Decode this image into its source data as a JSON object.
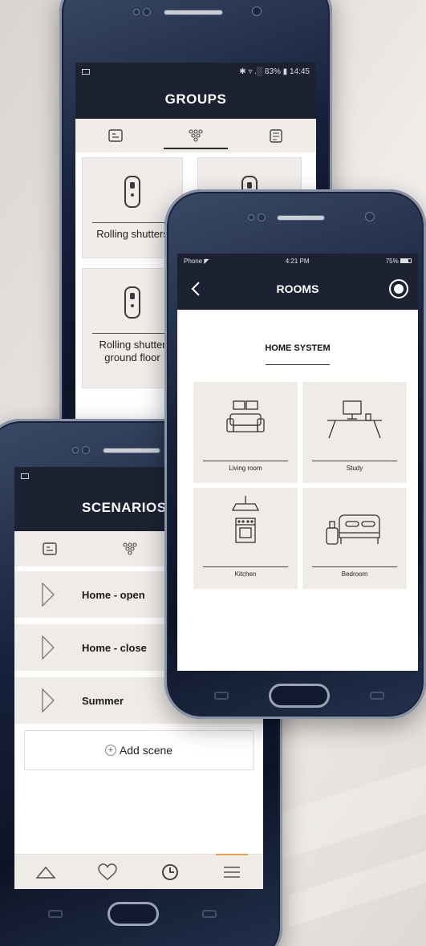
{
  "groups_screen": {
    "status": "✱ ▿ .░ 83% ▮ 14:45",
    "title": "GROUPS",
    "tab_icons": [
      "device-icon",
      "groups-icon",
      "scenario-icon"
    ],
    "active_tab": 1,
    "cards": [
      {
        "label": "Rolling shutters"
      },
      {
        "label": ""
      },
      {
        "label": "Rolling shutter ground floor"
      },
      {
        "label": ""
      }
    ]
  },
  "scenarios_screen": {
    "title": "SCENARIOS",
    "tab_icons": [
      "device-icon",
      "groups-icon"
    ],
    "scenes": [
      {
        "name": "Home - open"
      },
      {
        "name": "Home - close"
      },
      {
        "name": "Summer"
      }
    ],
    "add_label": "Add scene",
    "nav_icons": [
      "home-icon",
      "favorites-icon",
      "clock-icon",
      "menu-icon"
    ],
    "accent_color": "#e8a04a"
  },
  "rooms_screen": {
    "carrier": "Phone",
    "time": "4:21 PM",
    "battery": "75%",
    "title": "ROOMS",
    "section_title": "HOME SYSTEM",
    "rooms": [
      {
        "label": "Living room",
        "icon": "sofa-icon"
      },
      {
        "label": "Study",
        "icon": "desk-icon"
      },
      {
        "label": "Kitchen",
        "icon": "oven-icon"
      },
      {
        "label": "Bedroom",
        "icon": "bed-icon"
      }
    ]
  },
  "colors": {
    "header_bg": "#1d2233",
    "card_bg": "#efebe7",
    "phone_body": "#16203a"
  }
}
